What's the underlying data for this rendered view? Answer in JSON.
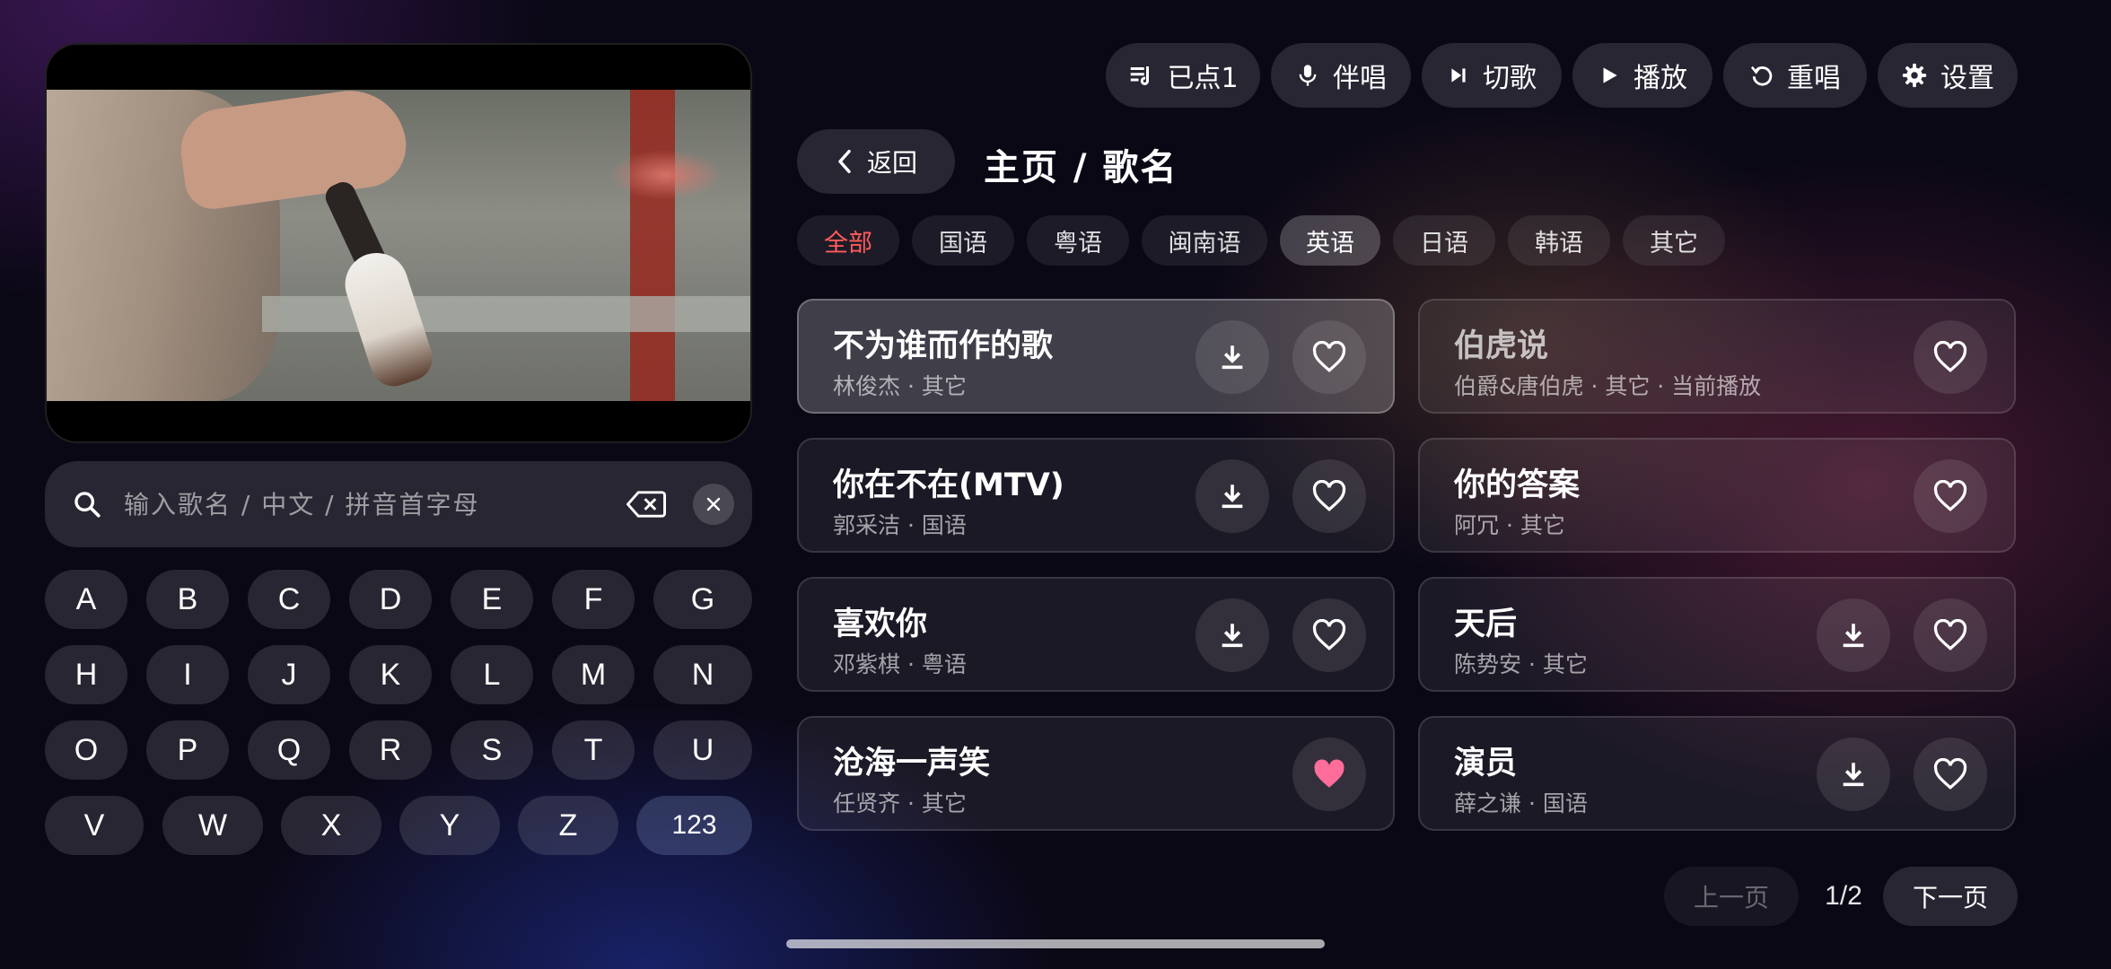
{
  "toolbar": {
    "queue_label": "已点1",
    "accompany_label": "伴唱",
    "switch_label": "切歌",
    "play_label": "播放",
    "replay_label": "重唱",
    "settings_label": "设置"
  },
  "nav": {
    "back_label": "返回",
    "breadcrumb": "主页 / 歌名"
  },
  "search": {
    "placeholder": "输入歌名 / 中文 / 拼音首字母",
    "value": ""
  },
  "filters": [
    "全部",
    "国语",
    "粤语",
    "闽南语",
    "英语",
    "日语",
    "韩语",
    "其它"
  ],
  "filter_state": {
    "active": "全部",
    "highlighted": "英语"
  },
  "keyboard": {
    "row1": [
      "A",
      "B",
      "C",
      "D",
      "E",
      "F",
      "G"
    ],
    "row2": [
      "H",
      "I",
      "J",
      "K",
      "L",
      "M",
      "N"
    ],
    "row3": [
      "O",
      "P",
      "Q",
      "R",
      "S",
      "T",
      "U"
    ],
    "row4": [
      "V",
      "W",
      "X",
      "Y",
      "Z",
      "123"
    ]
  },
  "songs": [
    {
      "title": "不为谁而作的歌",
      "meta": "林俊杰 · 其它",
      "download": true,
      "favorite": false,
      "selected": true
    },
    {
      "title": "伯虎说",
      "meta": "伯爵&唐伯虎 · 其它 · 当前播放",
      "download": false,
      "favorite": false,
      "selected": false
    },
    {
      "title": "你在不在(MTV)",
      "meta": "郭采洁 · 国语",
      "download": true,
      "favorite": false,
      "selected": false
    },
    {
      "title": "你的答案",
      "meta": "阿冗 · 其它",
      "download": false,
      "favorite": false,
      "selected": false
    },
    {
      "title": "喜欢你",
      "meta": "邓紫棋 · 粤语",
      "download": true,
      "favorite": false,
      "selected": false
    },
    {
      "title": "天后",
      "meta": "陈势安 · 其它",
      "download": true,
      "favorite": false,
      "selected": false
    },
    {
      "title": "沧海一声笑",
      "meta": "任贤齐 · 其它",
      "download": false,
      "favorite": true,
      "selected": false
    },
    {
      "title": "演员",
      "meta": "薛之谦 · 国语",
      "download": true,
      "favorite": false,
      "selected": false
    }
  ],
  "pagination": {
    "prev_label": "上一页",
    "page": "1/2",
    "next_label": "下一页"
  },
  "colors": {
    "accent_red": "#ff5b5b",
    "favorite_pink": "#ff6d9a"
  }
}
